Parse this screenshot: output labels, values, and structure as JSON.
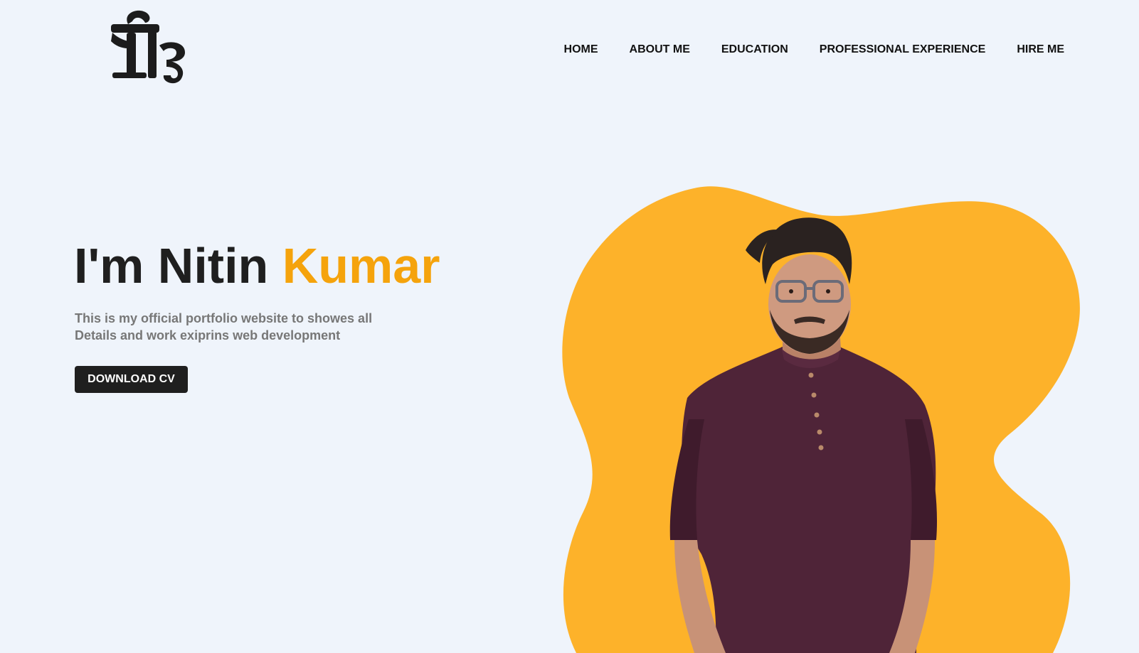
{
  "logo": {
    "text": "निउ",
    "icon": "logo-glyph"
  },
  "nav": {
    "items": [
      {
        "label": "HOME"
      },
      {
        "label": "ABOUT ME"
      },
      {
        "label": "EDUCATION"
      },
      {
        "label": "PROFESSIONAL EXPERIENCE"
      },
      {
        "label": "HIRE ME"
      }
    ]
  },
  "hero": {
    "title_prefix": "I'm Nitin ",
    "title_accent": "Kumar",
    "desc_line1": "This is my official portfolio website to showes all",
    "desc_line2": "Details and work exiprins web development",
    "cta_label": "DOWNLOAD CV"
  },
  "colors": {
    "background": "#eff4fb",
    "accent": "#f5a30c",
    "blob": "#fdb22a",
    "dark": "#1f1f1f",
    "muted": "#777777",
    "shirt": "#4e2436"
  },
  "hero_image": {
    "icon": "portrait-illustration"
  }
}
